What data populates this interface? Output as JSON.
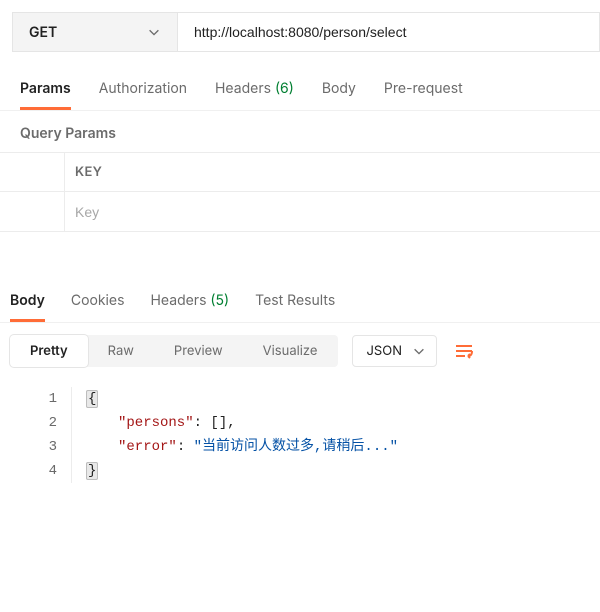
{
  "request": {
    "method": "GET",
    "url": "http://localhost:8080/person/select"
  },
  "tabs_req": {
    "params": "Params",
    "auth": "Authorization",
    "headers_label": "Headers",
    "headers_count": "(6)",
    "body": "Body",
    "prereq": "Pre-request"
  },
  "query": {
    "title": "Query Params",
    "key_header": "KEY",
    "key_placeholder": "Key"
  },
  "tabs_resp": {
    "body": "Body",
    "cookies": "Cookies",
    "headers_label": "Headers",
    "headers_count": "(5)",
    "tests": "Test Results"
  },
  "views": {
    "pretty": "Pretty",
    "raw": "Raw",
    "preview": "Preview",
    "visualize": "Visualize",
    "format": "JSON"
  },
  "code": {
    "ln1": "1",
    "ln2": "2",
    "ln3": "3",
    "ln4": "4",
    "brace_open": "{",
    "brace_close": "}",
    "key_persons": "\"persons\"",
    "colon": ":",
    "val_persons": " []",
    "comma": ",",
    "key_error": "\"error\"",
    "val_error": " \"当前访问人数过多,请稍后...\""
  }
}
